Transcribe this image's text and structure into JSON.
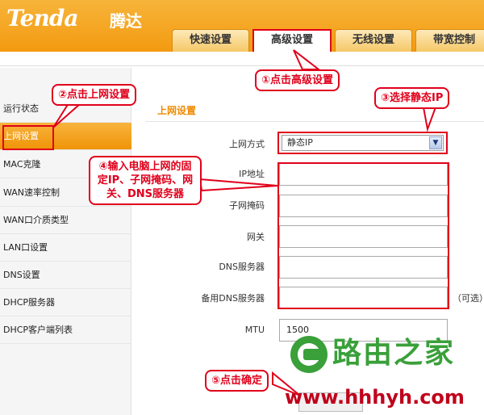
{
  "brand": {
    "logo": "Tenda",
    "logo_cn": "腾达"
  },
  "tabs": [
    {
      "label": "快速设置"
    },
    {
      "label": "高级设置"
    },
    {
      "label": "无线设置"
    },
    {
      "label": "带宽控制"
    }
  ],
  "sidebar": {
    "items": [
      {
        "label": "运行状态"
      },
      {
        "label": "上网设置"
      },
      {
        "label": "MAC克隆"
      },
      {
        "label": "WAN速率控制"
      },
      {
        "label": "WAN口介质类型"
      },
      {
        "label": "LAN口设置"
      },
      {
        "label": "DNS设置"
      },
      {
        "label": "DHCP服务器"
      },
      {
        "label": "DHCP客户端列表"
      }
    ]
  },
  "main": {
    "title": "上网设置",
    "fields": {
      "mode_label": "上网方式",
      "mode_value": "静态IP",
      "ip_label": "IP地址",
      "mask_label": "子网掩码",
      "gateway_label": "网关",
      "dns_label": "DNS服务器",
      "dns2_label": "备用DNS服务器",
      "dns2_note": "（可选）",
      "mtu_label": "MTU",
      "mtu_value": "1500"
    }
  },
  "callouts": {
    "step1": "①点击高级设置",
    "step2": "②点击上网设置",
    "step3": "③选择静态IP",
    "step4": "④输入电脑上网的固定IP、子网掩码、网关、DNS服务器",
    "step5": "⑤点击确定"
  },
  "watermark": {
    "logo_text": "路由之家",
    "url": "www.hhhyh.com"
  },
  "colors": {
    "accent": "#f39a10",
    "annotation": "#e0001b",
    "watermark_green": "#3aa03a",
    "watermark_red": "#c0001a"
  }
}
